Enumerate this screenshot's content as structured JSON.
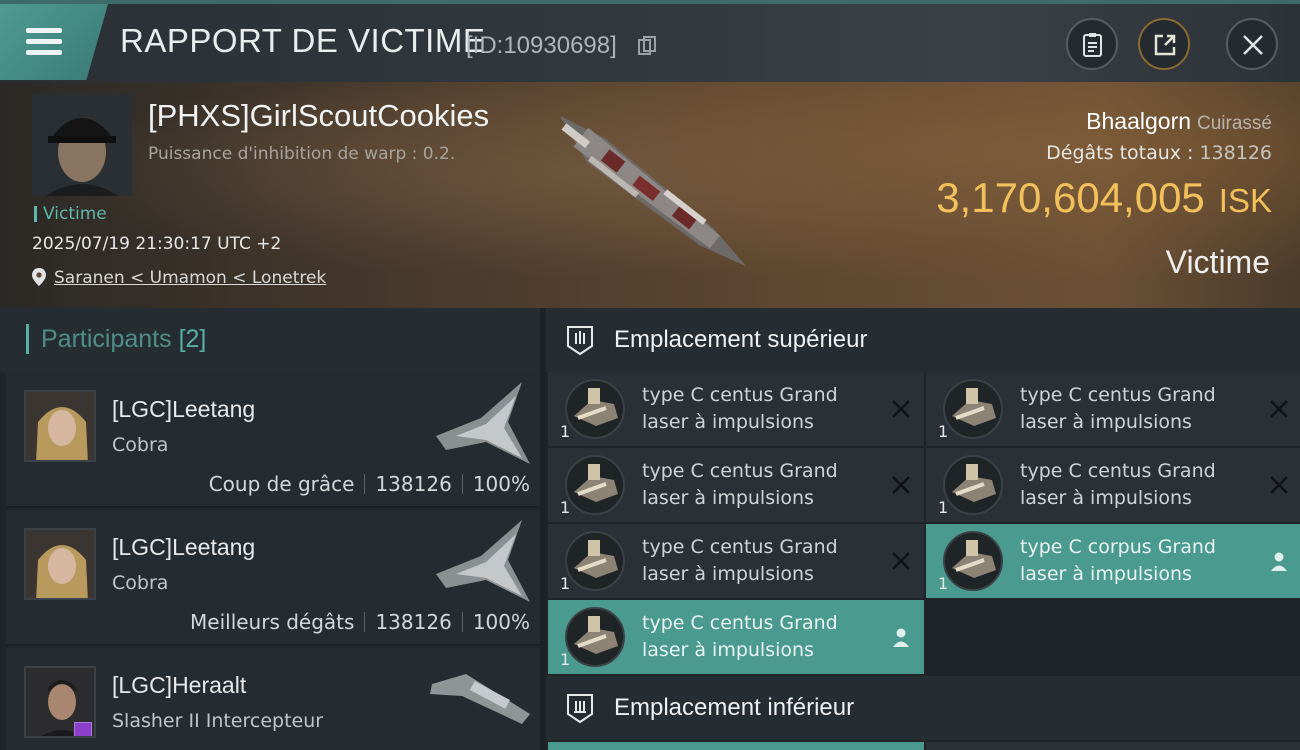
{
  "header": {
    "title": "RAPPORT DE VICTIME",
    "report_id": "[ID:10930698]",
    "icons": [
      "menu-icon",
      "copy-icon",
      "clipboard-icon",
      "share-icon",
      "close-icon"
    ]
  },
  "victim": {
    "name": "[PHXS]GirlScoutCookies",
    "warp_inhibition": "Puissance d'inhibition de warp : 0.2.",
    "role_tag": "Victime",
    "datetime": "2025/07/19 21:30:17 UTC +2",
    "location": "Saranen < Umamon < Lonetrek",
    "ship_name": "Bhaalgorn",
    "ship_class": "Cuirassé",
    "damage_label": "Dégâts totaux :",
    "damage_value": "138126",
    "isk_value": "3,170,604,005",
    "isk_unit": "ISK",
    "role_right": "Victime"
  },
  "participants": {
    "title": "Participants",
    "count": "[2]",
    "items": [
      {
        "name": "[LGC]Leetang",
        "ship": "Cobra",
        "stat_label": "Coup de grâce",
        "damage": "138126",
        "percent": "100%"
      },
      {
        "name": "[LGC]Leetang",
        "ship": "Cobra",
        "stat_label": "Meilleurs dégâts",
        "damage": "138126",
        "percent": "100%"
      },
      {
        "name": "[LGC]Heraalt",
        "ship": "Slasher II Intercepteur",
        "stat_label": "",
        "damage": "",
        "percent": ""
      }
    ]
  },
  "modules": {
    "high_slot_title": "Emplacement supérieur",
    "low_slot_title": "Emplacement inférieur",
    "high": [
      {
        "name_line1": "type C centus Grand",
        "name_line2": "laser à impulsions",
        "qty": "1",
        "status": "destroyed"
      },
      {
        "name_line1": "type C centus Grand",
        "name_line2": "laser à impulsions",
        "qty": "1",
        "status": "destroyed"
      },
      {
        "name_line1": "type C centus Grand",
        "name_line2": "laser à impulsions",
        "qty": "1",
        "status": "destroyed"
      },
      {
        "name_line1": "type C centus Grand",
        "name_line2": "laser à impulsions",
        "qty": "1",
        "status": "destroyed"
      },
      {
        "name_line1": "type C centus Grand",
        "name_line2": "laser à impulsions",
        "qty": "1",
        "status": "destroyed"
      },
      {
        "name_line1": "type C corpus Grand",
        "name_line2": "laser à impulsions",
        "qty": "1",
        "status": "dropped"
      },
      {
        "name_line1": "type C centus Grand",
        "name_line2": "laser à impulsions",
        "qty": "1",
        "status": "dropped"
      }
    ]
  },
  "colors": {
    "accent_teal": "#4a9a90",
    "isk_gold": "#f3c15c",
    "panel_dark": "#1e2429"
  }
}
